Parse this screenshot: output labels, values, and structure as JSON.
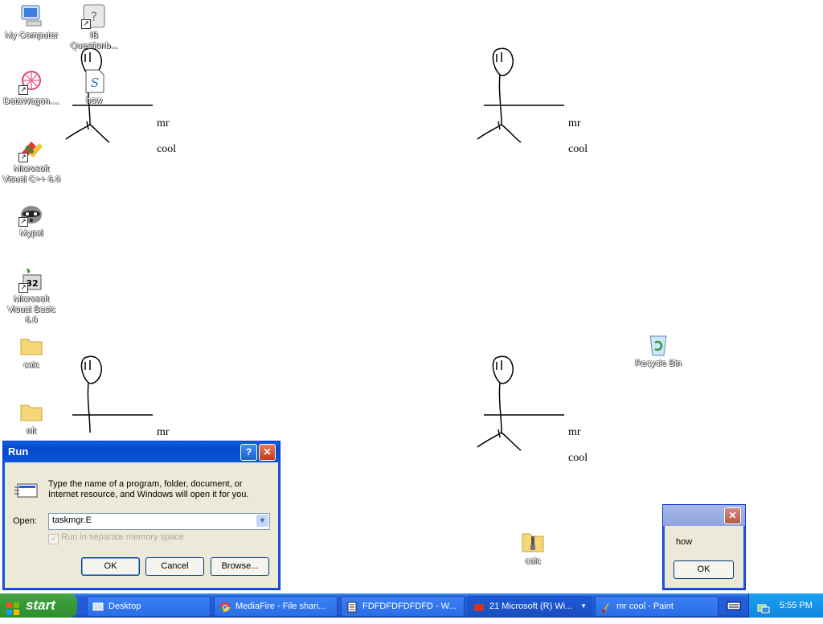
{
  "desktop_icons": [
    {
      "label": "My Computer",
      "icon": "my-computer-icon"
    },
    {
      "label": "IB Questionb...",
      "icon": "ib-questionbank-icon"
    },
    {
      "label": "how",
      "icon": "script-file-icon"
    },
    {
      "label": "DataWagon....",
      "icon": "datawagon-icon"
    },
    {
      "label": "Microsoft Visual C++ 6.0",
      "icon": "visual-cpp-icon"
    },
    {
      "label": "Mypal",
      "icon": "mypal-icon"
    },
    {
      "label": "Microsoft Visual Basic 6.0",
      "icon": "visual-basic-icon"
    },
    {
      "label": "calc",
      "icon": "folder-icon"
    },
    {
      "label": "nft",
      "icon": "folder-icon"
    },
    {
      "label": "Recycle Bin",
      "icon": "recycle-bin-icon"
    },
    {
      "label": "calc",
      "icon": "zip-folder-icon"
    }
  ],
  "drawing": {
    "word1": "mr",
    "word2": "cool"
  },
  "run_dialog": {
    "title": "Run",
    "description": "Type the name of a program, folder, document, or Internet resource, and Windows will open it for you.",
    "open_label": "Open:",
    "open_value": "taskmgr.E",
    "checkbox_label": "Run in separate memory space",
    "ok": "OK",
    "cancel": "Cancel",
    "browse": "Browse..."
  },
  "message_box": {
    "text": "how",
    "ok": "OK"
  },
  "taskbar": {
    "start": "start",
    "tasks": [
      "Desktop",
      "MediaFire - File shari...",
      "FDFDFDFDFDFD - W...",
      "21 Microsoft (R) Wi...",
      "mr cool - Paint"
    ],
    "clock": "5:55 PM"
  }
}
